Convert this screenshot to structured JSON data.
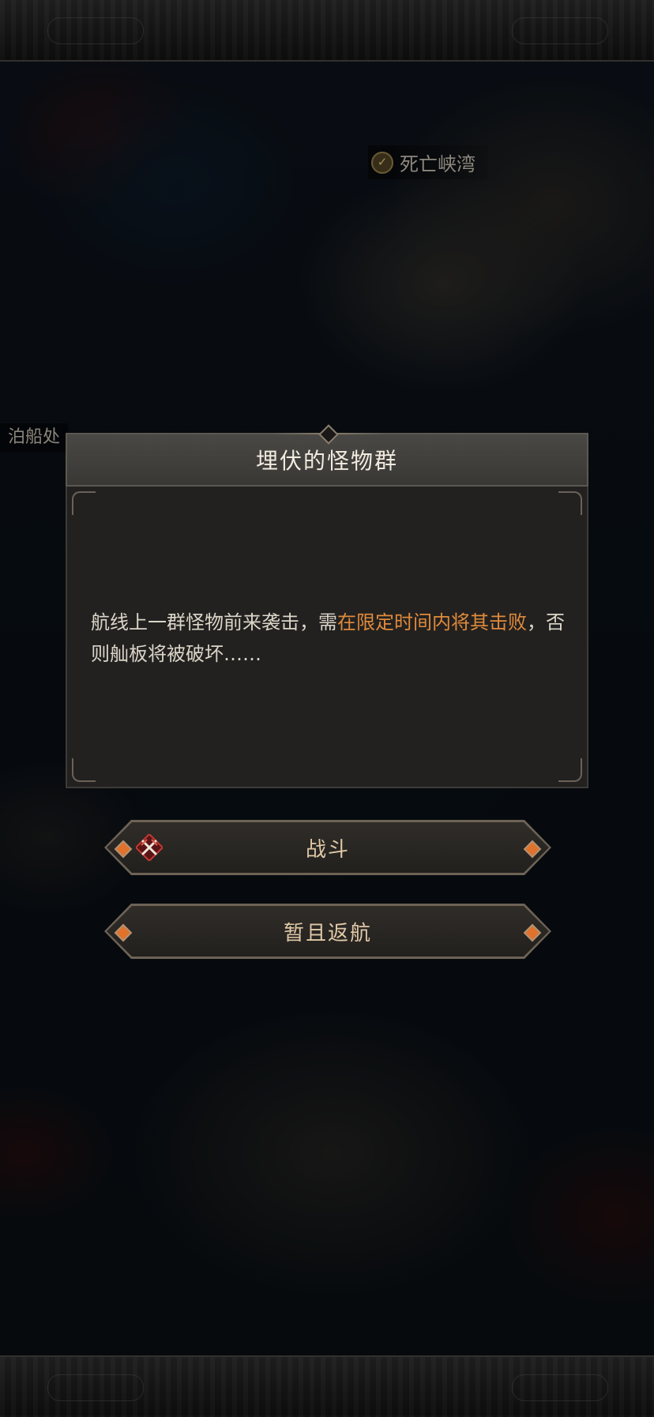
{
  "map": {
    "location_label": "死亡峡湾",
    "location_icon": "check-icon",
    "dock_label": "泊船处"
  },
  "modal": {
    "title": "埋伏的怪物群",
    "text_before": "航线上一群怪物前来袭击，需",
    "text_highlight": "在限定时间内将其击败",
    "text_after": "，否则舢板将被破坏……",
    "highlight_color": "#e08a3a"
  },
  "buttons": {
    "fight_label": "战斗",
    "fight_icon": "crossed-swords-icon",
    "return_label": "暂且返航"
  }
}
